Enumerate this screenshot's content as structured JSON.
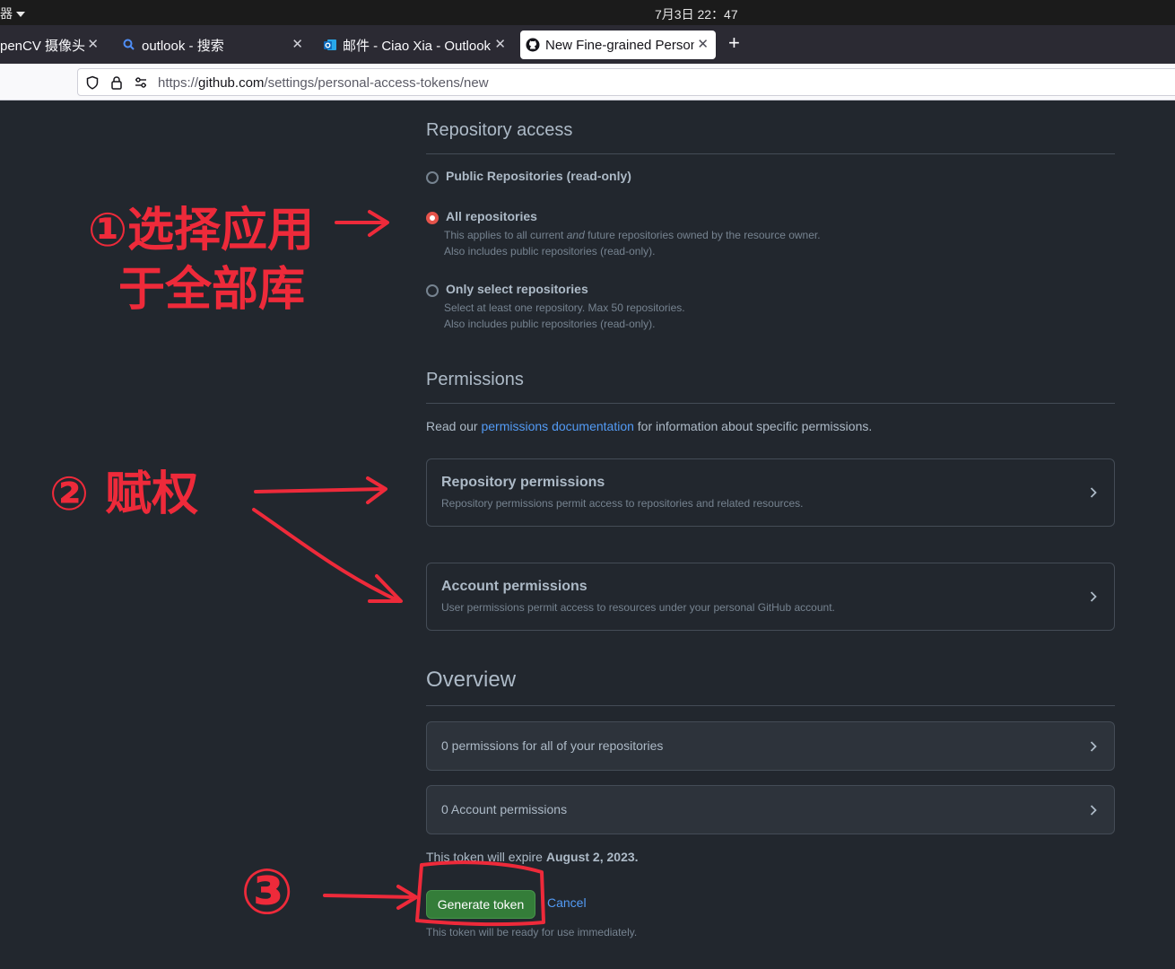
{
  "os": {
    "menu_label": "器",
    "clock": "7月3日  22：47"
  },
  "tabs": [
    {
      "title": "penCV 摄像头 C",
      "active": false
    },
    {
      "title": "outlook - 搜索",
      "active": false
    },
    {
      "title": "邮件 - Ciao Xia - Outlook",
      "active": false
    },
    {
      "title": "New Fine-grained Person",
      "active": true
    }
  ],
  "tab_new_label": "+",
  "address": {
    "scheme": "https://",
    "host": "github.com",
    "path": "/settings/personal-access-tokens/new"
  },
  "repo_access": {
    "heading": "Repository access",
    "options": [
      {
        "label": "Public Repositories (read-only)",
        "checked": false,
        "desc1": "",
        "desc2": ""
      },
      {
        "label": "All repositories",
        "checked": true,
        "desc1_pre": "This applies to all current ",
        "desc1_em": "and",
        "desc1_post": " future repositories owned by the resource owner.",
        "desc2": "Also includes public repositories (read-only)."
      },
      {
        "label": "Only select repositories",
        "checked": false,
        "desc1": "Select at least one repository. Max 50 repositories.",
        "desc2": "Also includes public repositories (read-only)."
      }
    ]
  },
  "permissions": {
    "heading": "Permissions",
    "intro_pre": "Read our ",
    "intro_link": "permissions documentation",
    "intro_post": " for information about specific permissions.",
    "repo_title": "Repository permissions",
    "repo_desc": "Repository permissions permit access to repositories and related resources.",
    "account_title": "Account permissions",
    "account_desc": "User permissions permit access to resources under your personal GitHub account."
  },
  "overview": {
    "heading": "Overview",
    "repo_summary": "0 permissions for all of your repositories",
    "account_summary": "0 Account permissions"
  },
  "expiry": {
    "pre": "This token will expire ",
    "date": "August 2, 2023."
  },
  "actions": {
    "generate": "Generate token",
    "cancel": "Cancel",
    "note": "This token will be ready for use immediately."
  },
  "annotations": {
    "step1_line1": "①选择应用",
    "step1_line2": "于全部库",
    "step2": "② 赋权",
    "step3": "③",
    "color": "#ee2a3a"
  },
  "colors": {
    "accent": "#539bf5",
    "button": "#347d39",
    "selected_radio": "#e5534b",
    "bg": "#22272e"
  }
}
